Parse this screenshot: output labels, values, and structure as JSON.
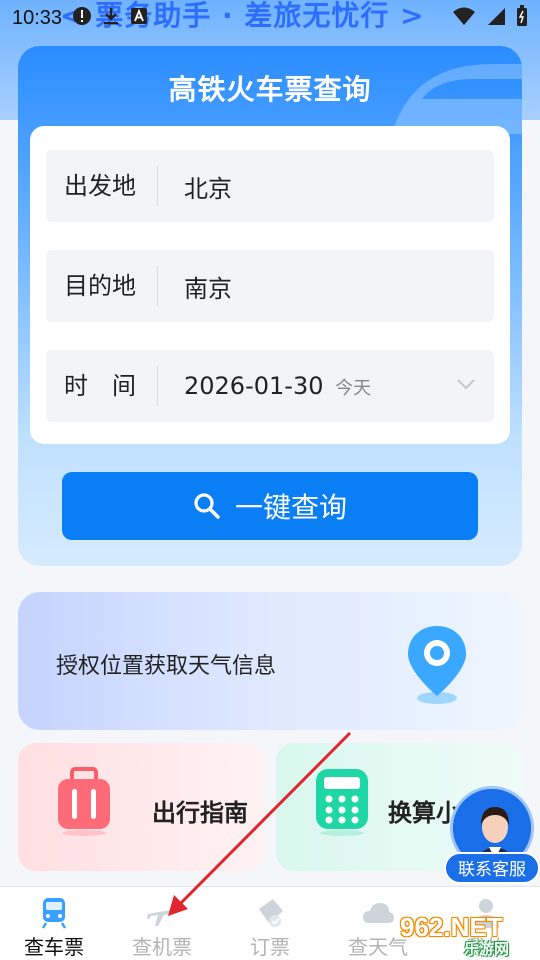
{
  "status_bar": {
    "time": "10:33"
  },
  "header": {
    "title": "< 票务助手 · 差旅无忧行 >"
  },
  "search_card": {
    "title": "高铁火车票查询",
    "from_label": "出发地",
    "from_value": "北京",
    "to_label": "目的地",
    "to_value": "南京",
    "date_label": "时　间",
    "date_value": "2026-01-30",
    "date_hint": "今天",
    "search_button": "一键查询"
  },
  "weather": {
    "text": "授权位置获取天气信息"
  },
  "tiles": {
    "guide": "出行指南",
    "convert": "换算小"
  },
  "contact": {
    "label": "联系客服"
  },
  "bottom_nav": {
    "items": [
      {
        "label": "查车票",
        "icon": "train-icon",
        "active": true
      },
      {
        "label": "查机票",
        "icon": "plane-icon",
        "active": false
      },
      {
        "label": "订票",
        "icon": "ticket-icon",
        "active": false
      },
      {
        "label": "查天气",
        "icon": "cloud-icon",
        "active": false
      },
      {
        "label": "我的",
        "icon": "user-icon",
        "active": false
      }
    ]
  },
  "watermark": {
    "logo": "962.NET",
    "sub": "乐游网"
  },
  "colors": {
    "primary": "#0a7ef5",
    "card_top": "#2a8cff",
    "text": "#222222"
  }
}
